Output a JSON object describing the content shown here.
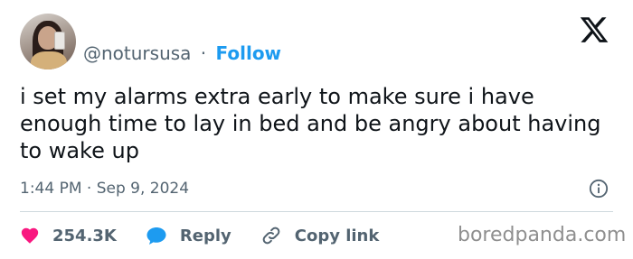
{
  "header": {
    "handle": "@notursusa",
    "separator": "·",
    "follow_label": "Follow"
  },
  "icons": {
    "platform_logo": "x-logo-icon",
    "info": "info-icon",
    "like": "heart-icon",
    "reply": "speech-bubble-icon",
    "copy_link": "link-icon"
  },
  "tweet": {
    "text": "i set my alarms extra early to make sure i have enough time to lay in bed and be angry about having to wake up",
    "timestamp": "1:44 PM · Sep 9, 2024"
  },
  "actions": {
    "likes_count": "254.3K",
    "reply_label": "Reply",
    "copy_link_label": "Copy link"
  },
  "watermark": "boredpanda.com",
  "colors": {
    "follow": "#1d9bf0",
    "like_heart": "#f91880",
    "reply_bubble": "#1d9bf0",
    "secondary_text": "#536471",
    "primary_text": "#0f1419"
  }
}
